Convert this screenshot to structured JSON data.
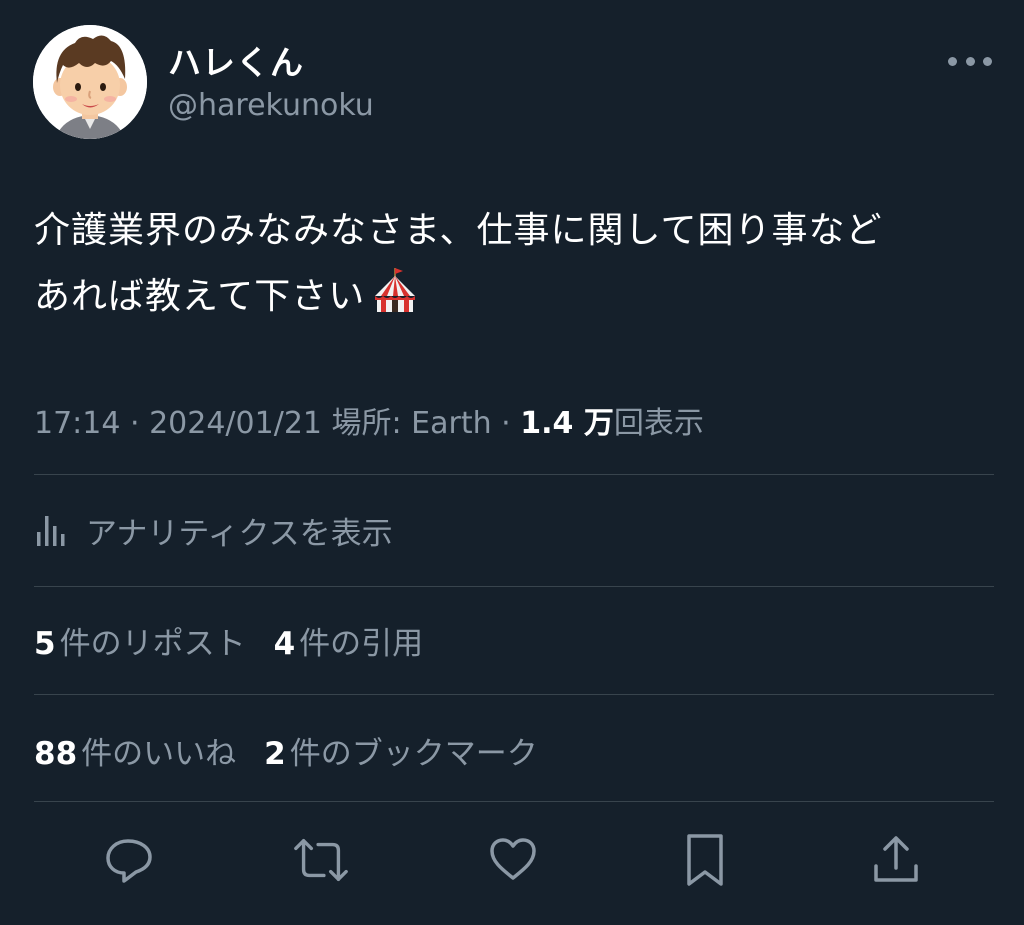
{
  "user": {
    "display_name": "ハレくん",
    "handle": "@harekunoku",
    "avatar_icon": "avatar-illustration"
  },
  "tweet": {
    "text_line1": "介護業界のみなみなさま、仕事に関して困り事など",
    "text_line2": "あれば教えて下さい",
    "emoji": "circus-tent"
  },
  "meta": {
    "time": "17:14",
    "sep1": " · ",
    "date": "2024/01/21",
    "location_label": " 場所: Earth",
    "sep2": " · ",
    "views_count": "1.4 万",
    "views_label": "回表示"
  },
  "analytics": {
    "label": "アナリティクスを表示",
    "icon": "bar-chart-icon"
  },
  "stats": {
    "reposts_count": "5",
    "reposts_label": "件のリポスト",
    "quotes_count": "4",
    "quotes_label": "件の引用",
    "likes_count": "88",
    "likes_label": "件のいいね",
    "bookmarks_count": "2",
    "bookmarks_label": "件のブックマーク"
  },
  "actions": [
    "reply-icon",
    "retweet-icon",
    "like-icon",
    "bookmark-icon",
    "share-icon"
  ],
  "colors": {
    "background": "#15202b",
    "primary_text": "#ffffff",
    "secondary_text": "#8b98a5",
    "divider": "#38444d"
  }
}
